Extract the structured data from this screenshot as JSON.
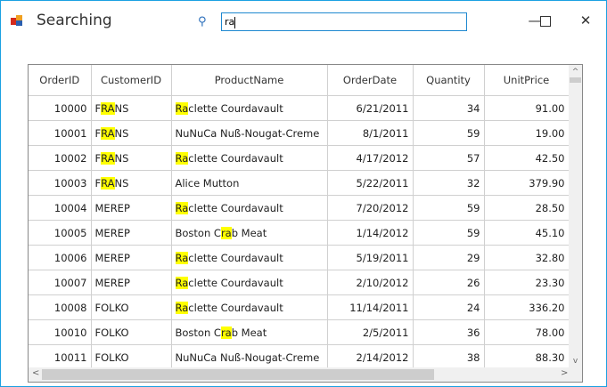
{
  "window": {
    "title": "Searching",
    "minimize": "—",
    "maximize": "☐",
    "close": "✕"
  },
  "search": {
    "value": "ra",
    "icon": "search-icon"
  },
  "colors": {
    "highlight": "#ffff00",
    "border": "#1ba1e2"
  },
  "grid": {
    "columns": [
      "OrderID",
      "CustomerID",
      "ProductName",
      "OrderDate",
      "Quantity",
      "UnitPrice"
    ],
    "rows": [
      {
        "OrderID": "10000",
        "CustomerID": [
          "F",
          "RA",
          "NS"
        ],
        "ProductName": [
          "",
          "Ra",
          "clette Courdavault"
        ],
        "OrderDate": "6/21/2011",
        "Quantity": "34",
        "UnitPrice": "91.00"
      },
      {
        "OrderID": "10001",
        "CustomerID": [
          "F",
          "RA",
          "NS"
        ],
        "ProductName": [
          "NuNuCa Nuß-Nougat-Creme",
          "",
          ""
        ],
        "OrderDate": "8/1/2011",
        "Quantity": "59",
        "UnitPrice": "19.00"
      },
      {
        "OrderID": "10002",
        "CustomerID": [
          "F",
          "RA",
          "NS"
        ],
        "ProductName": [
          "",
          "Ra",
          "clette Courdavault"
        ],
        "OrderDate": "4/17/2012",
        "Quantity": "57",
        "UnitPrice": "42.50"
      },
      {
        "OrderID": "10003",
        "CustomerID": [
          "F",
          "RA",
          "NS"
        ],
        "ProductName": [
          "Alice Mutton",
          "",
          ""
        ],
        "OrderDate": "5/22/2011",
        "Quantity": "32",
        "UnitPrice": "379.90"
      },
      {
        "OrderID": "10004",
        "CustomerID": [
          "MEREP",
          "",
          ""
        ],
        "ProductName": [
          "",
          "Ra",
          "clette Courdavault"
        ],
        "OrderDate": "7/20/2012",
        "Quantity": "59",
        "UnitPrice": "28.50"
      },
      {
        "OrderID": "10005",
        "CustomerID": [
          "MEREP",
          "",
          ""
        ],
        "ProductName": [
          "Boston C",
          "ra",
          "b Meat"
        ],
        "OrderDate": "1/14/2012",
        "Quantity": "59",
        "UnitPrice": "45.10"
      },
      {
        "OrderID": "10006",
        "CustomerID": [
          "MEREP",
          "",
          ""
        ],
        "ProductName": [
          "",
          "Ra",
          "clette Courdavault"
        ],
        "OrderDate": "5/19/2011",
        "Quantity": "29",
        "UnitPrice": "32.80"
      },
      {
        "OrderID": "10007",
        "CustomerID": [
          "MEREP",
          "",
          ""
        ],
        "ProductName": [
          "",
          "Ra",
          "clette Courdavault"
        ],
        "OrderDate": "2/10/2012",
        "Quantity": "26",
        "UnitPrice": "23.30"
      },
      {
        "OrderID": "10008",
        "CustomerID": [
          "FOLKO",
          "",
          ""
        ],
        "ProductName": [
          "",
          "Ra",
          "clette Courdavault"
        ],
        "OrderDate": "11/14/2011",
        "Quantity": "24",
        "UnitPrice": "336.20"
      },
      {
        "OrderID": "10010",
        "CustomerID": [
          "FOLKO",
          "",
          ""
        ],
        "ProductName": [
          "Boston C",
          "ra",
          "b Meat"
        ],
        "OrderDate": "2/5/2011",
        "Quantity": "36",
        "UnitPrice": "78.00"
      },
      {
        "OrderID": "10011",
        "CustomerID": [
          "FOLKO",
          "",
          ""
        ],
        "ProductName": [
          "NuNuCa Nuß-Nougat-Creme",
          "",
          ""
        ],
        "OrderDate": "2/14/2012",
        "Quantity": "38",
        "UnitPrice": "88.30"
      }
    ]
  }
}
